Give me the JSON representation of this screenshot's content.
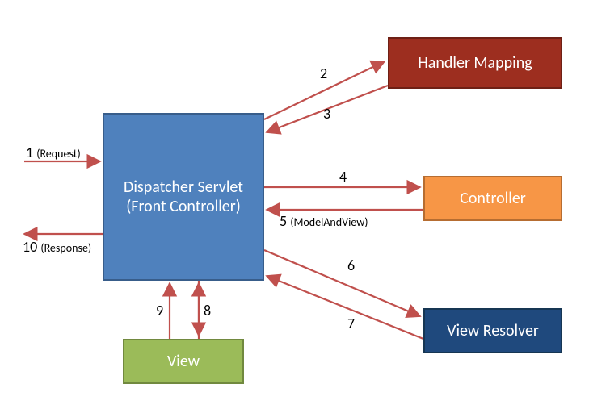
{
  "boxes": {
    "dispatcher_line1": "Dispatcher Servlet",
    "dispatcher_line2": "(Front Controller)",
    "handler": "Handler Mapping",
    "controller": "Controller",
    "resolver": "View Resolver",
    "view": "View"
  },
  "labels": {
    "one": "1",
    "one_paren": "(Request)",
    "two": "2",
    "three": "3",
    "four": "4",
    "five": "5",
    "five_paren": "(ModelAndView)",
    "six": "6",
    "seven": "7",
    "eight": "8",
    "nine": "9",
    "ten": "10",
    "ten_paren": "(Response)"
  }
}
